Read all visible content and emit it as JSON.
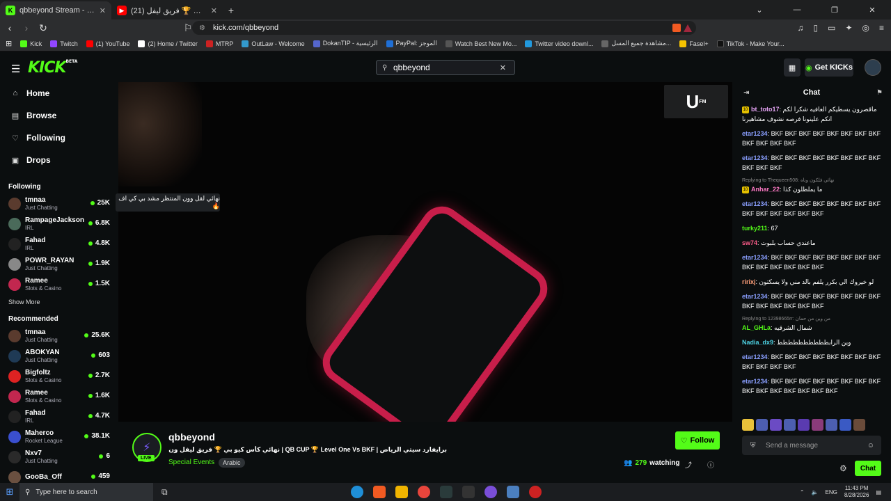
{
  "browser": {
    "tabs": [
      {
        "title": "qbbeyond Stream - Watch Li...",
        "favicon": "K",
        "color": "#53fc18"
      },
      {
        "title": "(21) نهائي كأس كيو بي 🏆 فريق ليفل ...",
        "favicon": "▶",
        "color": "#ff0000"
      }
    ],
    "url": "kick.com/qbbeyond",
    "bookmarks": [
      {
        "label": "Kick",
        "color": "#53fc18"
      },
      {
        "label": "Twitch",
        "color": "#9146ff"
      },
      {
        "label": "(1) YouTube",
        "color": "#ff0000"
      },
      {
        "label": "(2) Home / Twitter",
        "color": "#ffffff"
      },
      {
        "label": "MTRP",
        "color": "#cc2222"
      },
      {
        "label": "OutLaw - Welcome",
        "color": "#3399cc"
      },
      {
        "label": "DokanTIP - الرئيسية",
        "color": "#5566cc"
      },
      {
        "label": "PayPal: الموجز",
        "color": "#1f6fd6"
      },
      {
        "label": "Watch Best New Mo...",
        "color": "#222222"
      },
      {
        "label": "Twitter video downl...",
        "color": "#2299dd"
      },
      {
        "label": "مشاهدة جميع المسل...",
        "color": "#444444"
      },
      {
        "label": "Fasel+",
        "color": "#f5c200"
      },
      {
        "label": "TikTok - Make Your...",
        "color": "#000000"
      }
    ]
  },
  "header": {
    "logo": "KICK",
    "logo_badge": "BETA",
    "search_value": "qbbeyond",
    "get_kicks": "Get KICKs"
  },
  "nav": [
    {
      "label": "Home",
      "icon": "⌂"
    },
    {
      "label": "Browse",
      "icon": "▤"
    },
    {
      "label": "Following",
      "icon": "♡"
    },
    {
      "label": "Drops",
      "icon": "▣"
    }
  ],
  "following_title": "Following",
  "following": [
    {
      "name": "tmnaa",
      "category": "Just Chatting",
      "viewers": "25K"
    },
    {
      "name": "RampageJackson",
      "category": "IRL",
      "viewers": "6.8K"
    },
    {
      "name": "Fahad",
      "category": "IRL",
      "viewers": "4.8K"
    },
    {
      "name": "POWR_RAYAN",
      "category": "Just Chatting",
      "viewers": "1.9K"
    },
    {
      "name": "Ramee",
      "category": "Slots & Casino",
      "viewers": "1.5K"
    }
  ],
  "show_more": "Show More",
  "recommended_title": "Recommended",
  "recommended": [
    {
      "name": "tmnaa",
      "category": "Just Chatting",
      "viewers": "25.6K"
    },
    {
      "name": "ABOKYAN",
      "category": "Just Chatting",
      "viewers": "603"
    },
    {
      "name": "Bigfoltz",
      "category": "Slots & Casino",
      "viewers": "2.7K"
    },
    {
      "name": "Ramee",
      "category": "Slots & Casino",
      "viewers": "1.6K"
    },
    {
      "name": "Fahad",
      "category": "IRL",
      "viewers": "4.7K"
    },
    {
      "name": "Maherco",
      "category": "Rocket League",
      "viewers": "38.1K"
    },
    {
      "name": "Nxv7",
      "category": "Just Chatting",
      "viewers": "6"
    },
    {
      "name": "GooBa_Off",
      "category": "",
      "viewers": "459"
    }
  ],
  "video": {
    "overlay_text": "نهائي لقل وون المنتظر مشد بي كي اف 🔥",
    "watermark": "U"
  },
  "stream": {
    "name": "qbbeyond",
    "live": "LIVE",
    "title": "برايفارد سيتي الرياض | QB CUP 🏆 Level One Vs BKF | نهائي كأس كيو بي 🏆 فريق ليفل ون ضد بي كي إف",
    "category": "Special Events",
    "tag": "Arabic",
    "follow": "Follow",
    "watching": "279",
    "watching_label": "watching"
  },
  "chat": {
    "title": "Chat",
    "messages": [
      {
        "user": "bt_toto17",
        "color": "#e6a4f5",
        "text": "ماقصرون يسطيكم العافيه شكرا لكم انكم علينونا فرصه نشوف مشاهيرنا",
        "badge": "10",
        "reply": ""
      },
      {
        "user": "etar1234",
        "color": "#8a9fff",
        "text": "BKF BKF BKF BKF BKF BKF BKF BKF BKF BKF BKF BKF",
        "badge": "",
        "reply": ""
      },
      {
        "user": "etar1234",
        "color": "#8a9fff",
        "text": "BKF BKF BKF BKF BKF BKF BKF BKF BKF BKF BKF",
        "badge": "",
        "reply": ""
      },
      {
        "user": "Anhar_22",
        "color": "#ff7ac6",
        "text": "ما يملطلون كذا",
        "badge": "10",
        "reply": "Replying to Thequeen508: نهائي فلكون وناه"
      },
      {
        "user": "etar1234",
        "color": "#8a9fff",
        "text": "BKF BKF BKF BKF BKF BKF BKF BKF BKF BKF BKF BKF BKF BKF",
        "badge": "",
        "reply": ""
      },
      {
        "user": "turky211",
        "color": "#53fc18",
        "text": "67",
        "badge": "",
        "reply": ""
      },
      {
        "user": "sw74",
        "color": "#ff5c8a",
        "text": "ماعندي حساب بلبوت",
        "badge": "",
        "reply": ""
      },
      {
        "user": "etar1234",
        "color": "#8a9fff",
        "text": "BKF BKF BKF BKF BKF BKF BKF BKF BKF BKF BKF BKF BKF BKF",
        "badge": "",
        "reply": ""
      },
      {
        "user": "ririxj",
        "color": "#ff9f7a",
        "text": "لو خيروك الي بكرر يلفم بالد مني ولا يسكتون",
        "badge": "",
        "reply": ""
      },
      {
        "user": "etar1234",
        "color": "#8a9fff",
        "text": "BKF BKF BKF BKF BKF BKF BKF BKF BKF BKF BKF BKF BKF BKF",
        "badge": "",
        "reply": ""
      },
      {
        "user": "AL_GHLa",
        "color": "#53fc18",
        "text": "شمال الشرقيه",
        "badge": "",
        "reply": "Replying to 12398665rr: من وين من حمان"
      },
      {
        "user": "Nadia_dx9",
        "color": "#4dd0e1",
        "text": "وين الرابطططططططططط",
        "badge": "",
        "reply": ""
      },
      {
        "user": "etar1234",
        "color": "#8a9fff",
        "text": "BKF BKF BKF BKF BKF BKF BKF BKF BKF BKF BKF BKF",
        "badge": "",
        "reply": ""
      },
      {
        "user": "etar1234",
        "color": "#8a9fff",
        "text": "BKF BKF BKF BKF BKF BKF BKF BKF BKF BKF BKF BKF BKF BKF BKF",
        "badge": "",
        "reply": ""
      }
    ],
    "placeholder": "Send a message",
    "send": "Chat"
  },
  "taskbar": {
    "search": "Type here to search",
    "lang": "ENG",
    "time": "11:43 PM",
    "date": "8/28/2026"
  }
}
